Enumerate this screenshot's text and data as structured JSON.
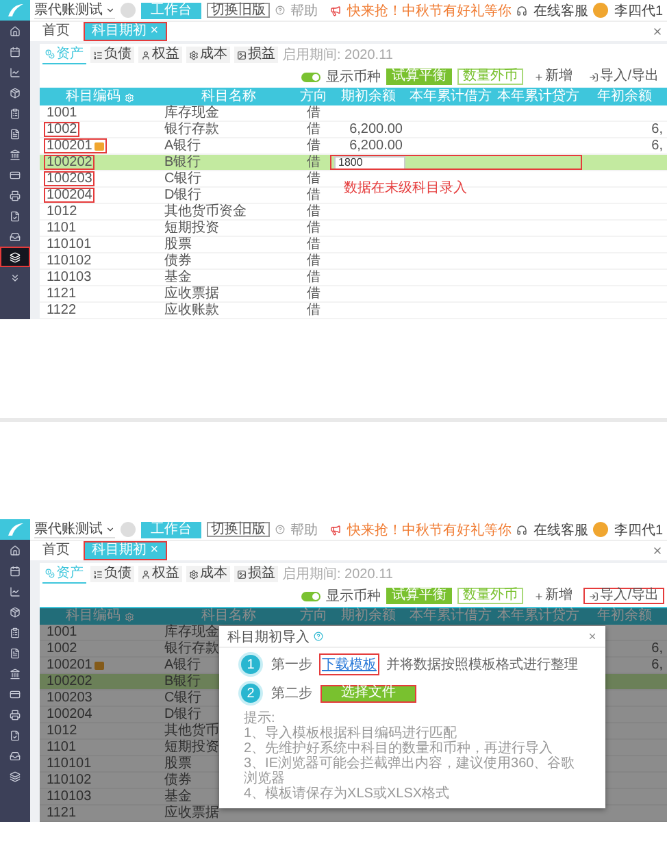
{
  "screens": [
    {
      "header": {
        "company": "票代账测试",
        "workbench": "工作台",
        "switch": "切换旧版",
        "help": "帮助",
        "promo": "快来抢！中秋节有好礼等你",
        "service": "在线客服",
        "user": "李四代1"
      },
      "sidebar": [
        {
          "selected": false
        },
        {
          "selected": false
        },
        {
          "selected": false
        },
        {
          "selected": false
        },
        {
          "selected": false
        },
        {
          "selected": false
        },
        {
          "selected": false
        },
        {
          "selected": false
        },
        {
          "selected": false
        },
        {
          "selected": false
        },
        {
          "selected": false
        },
        {
          "selected": true,
          "annotated": true
        },
        {
          "selected": false
        }
      ],
      "tabs": [
        {
          "label": "首页",
          "selected": false
        },
        {
          "label": "科目期初 ×",
          "selected": true,
          "annotated": true
        }
      ],
      "categories": [
        {
          "label": "资产",
          "selected": true
        },
        {
          "label": "负债",
          "selected": false
        },
        {
          "label": "权益",
          "selected": false
        },
        {
          "label": "成本",
          "selected": false
        },
        {
          "label": "损益",
          "selected": false
        }
      ],
      "period": "启用期间: 2020.11",
      "toggle": {
        "label": "显示币种",
        "on": true
      },
      "buttons": [
        {
          "label": "试算平衡",
          "kind": "primary"
        },
        {
          "label": "数量外币",
          "kind": "outline"
        },
        {
          "label": "新增",
          "kind": "add"
        },
        {
          "label": "导入/导出",
          "kind": "import",
          "annotated": false
        }
      ],
      "columns": [
        "科目编码",
        "科目名称",
        "方向",
        "期初余额",
        "本年累计借方",
        "本年累计贷方",
        "年初余额"
      ],
      "rows": [
        {
          "code": "1001",
          "name": "库存现金",
          "direction": "借"
        },
        {
          "code": "1002",
          "name": "银行存款",
          "direction": "借",
          "opening": "6,200.00",
          "year_start": "6,",
          "code_annotated": true
        },
        {
          "code": "100201",
          "tagged": true,
          "name": "A银行",
          "direction": "借",
          "opening": "6,200.00",
          "year_start": "6,",
          "code_annotated": true
        },
        {
          "code": "100202",
          "name": "B银行",
          "direction": "借",
          "editing": true,
          "input_value": "1800",
          "selected": true,
          "code_annotated": true,
          "box_annotated": true
        },
        {
          "code": "100203",
          "name": "C银行",
          "direction": "借",
          "code_annotated": true
        },
        {
          "code": "100204",
          "name": "D银行",
          "direction": "借",
          "code_annotated": true
        },
        {
          "code": "1012",
          "name": "其他货币资金",
          "direction": "借"
        },
        {
          "code": "1101",
          "name": "短期投资",
          "direction": "借"
        },
        {
          "code": "110101",
          "name": "股票",
          "direction": "借"
        },
        {
          "code": "110102",
          "name": "债券",
          "direction": "借"
        },
        {
          "code": "110103",
          "name": "基金",
          "direction": "借"
        },
        {
          "code": "1121",
          "name": "应收票据",
          "direction": "借"
        },
        {
          "code": "1122",
          "name": "应收账款",
          "direction": "借"
        }
      ],
      "note": "数据在末级科目录入"
    },
    {
      "header": {
        "company": "票代账测试",
        "workbench": "工作台",
        "switch": "切换旧版",
        "help": "帮助",
        "promo": "快来抢！中秋节有好礼等你",
        "service": "在线客服",
        "user": "李四代1"
      },
      "sidebar": [
        {
          "selected": false
        },
        {
          "selected": false
        },
        {
          "selected": false
        },
        {
          "selected": false
        },
        {
          "selected": false
        },
        {
          "selected": false
        },
        {
          "selected": false
        },
        {
          "selected": false
        },
        {
          "selected": false
        },
        {
          "selected": false
        },
        {
          "selected": false
        },
        {
          "selected": false
        }
      ],
      "tabs": [
        {
          "label": "首页",
          "selected": false
        },
        {
          "label": "科目期初 ×",
          "selected": true,
          "annotated": true
        }
      ],
      "categories": [
        {
          "label": "资产",
          "selected": true
        },
        {
          "label": "负债",
          "selected": false
        },
        {
          "label": "权益",
          "selected": false
        },
        {
          "label": "成本",
          "selected": false
        },
        {
          "label": "损益",
          "selected": false
        }
      ],
      "period": "启用期间: 2020.11",
      "toggle": {
        "label": "显示币种",
        "on": true
      },
      "buttons": [
        {
          "label": "试算平衡",
          "kind": "primary"
        },
        {
          "label": "数量外币",
          "kind": "outline"
        },
        {
          "label": "新增",
          "kind": "add"
        },
        {
          "label": "导入/导出",
          "kind": "import",
          "annotated": true
        }
      ],
      "columns": [
        "科目编码",
        "科目名称",
        "方向",
        "期初余额",
        "本年累计借方",
        "本年累计贷方",
        "年初余额"
      ],
      "rows": [
        {
          "code": "1001",
          "name": "库存现金"
        },
        {
          "code": "1002",
          "name": "银行存款",
          "year_start": "6,"
        },
        {
          "code": "100201",
          "tagged": true,
          "name": "A银行",
          "year_start": "6,"
        },
        {
          "code": "100202",
          "name": "B银行",
          "selected": true
        },
        {
          "code": "100203",
          "name": "C银行"
        },
        {
          "code": "100204",
          "name": "D银行"
        },
        {
          "code": "1012",
          "name": "其他货币"
        },
        {
          "code": "1101",
          "name": "短期投资"
        },
        {
          "code": "110101",
          "name": "股票"
        },
        {
          "code": "110102",
          "name": "债券"
        },
        {
          "code": "110103",
          "name": "基金"
        },
        {
          "code": "1121",
          "name": "应收票据"
        }
      ],
      "dialog": {
        "title": "科目期初导入",
        "steps": [
          {
            "num": "1",
            "label": "第一步",
            "link": "下载模板",
            "text": "并将数据按照模板格式进行整理"
          },
          {
            "num": "2",
            "label": "第二步",
            "button": "选择文件"
          }
        ],
        "tips_title": "提示:",
        "tips": [
          "1、导入模板根据科目编码进行匹配",
          "2、先维护好系统中科目的数量和币种，再进行导入",
          "3、IE浏览器可能会拦截弹出内容，建议使用360、谷歌浏览器",
          "4、模板请保存为XLS或XLSX格式"
        ]
      }
    }
  ]
}
